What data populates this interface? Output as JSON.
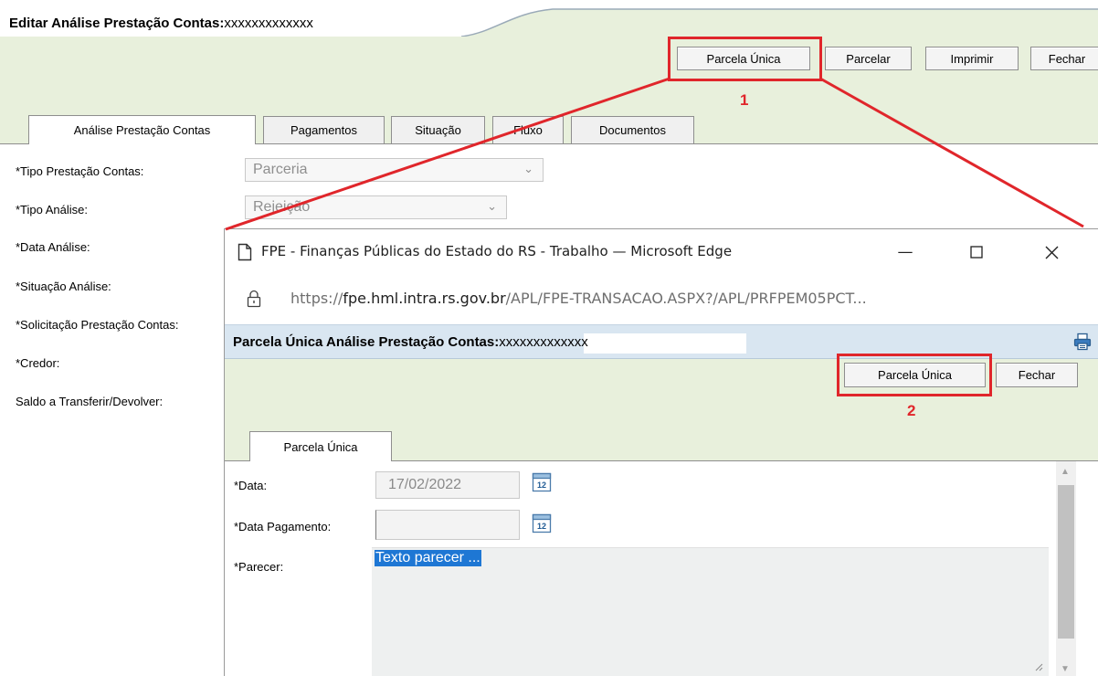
{
  "main": {
    "title_label": "Editar Análise Prestação Contas:",
    "title_code": "xxxxxxxxxxxxx",
    "buttons": {
      "parcela_unica": "Parcela Única",
      "parcelar": "Parcelar",
      "imprimir": "Imprimir",
      "fechar": "Fechar"
    },
    "tabs": [
      "Análise Prestação Contas",
      "Pagamentos",
      "Situação",
      "Fluxo",
      "Documentos"
    ],
    "fields": {
      "tipo_prestacao_label": "*Tipo Prestação Contas:",
      "tipo_prestacao_value": "Parceria",
      "tipo_analise_label": "*Tipo Análise:",
      "tipo_analise_value": "Rejeição",
      "data_analise_label": "*Data Análise:",
      "situacao_analise_label": "*Situação Análise:",
      "solicitacao_label": "*Solicitação Prestação Contas:",
      "credor_label": "*Credor:",
      "saldo_label": "Saldo a Transferir/Devolver:"
    }
  },
  "annotations": {
    "step1": "1",
    "step2": "2",
    "color": "#e0262b"
  },
  "popup": {
    "window_title": "FPE - Finanças Públicas do Estado do RS - Trabalho — Microsoft Edge",
    "url_prefix": "https://",
    "url_host": "fpe.hml.intra.rs.gov.br",
    "url_path": "/APL/FPE-TRANSACAO.ASPX?/APL/PRFPEM05PCT...",
    "title_label": "Parcela Única Análise Prestação Contas:",
    "title_code": "xxxxxxxxxxxxx",
    "buttons": {
      "parcela_unica": "Parcela Única",
      "fechar": "Fechar"
    },
    "tab": "Parcela Única",
    "fields": {
      "data_label": "*Data:",
      "data_value": "17/02/2022",
      "data_pagamento_label": "*Data Pagamento:",
      "data_pagamento_value": "",
      "parecer_label": "*Parecer:",
      "parecer_value": "Texto parecer ..."
    },
    "calendar_icon_text": "12"
  },
  "colors": {
    "green_band": "#e8f0dc",
    "title_bar_blue": "#d9e6f1",
    "selection_blue": "#1e77d4"
  }
}
